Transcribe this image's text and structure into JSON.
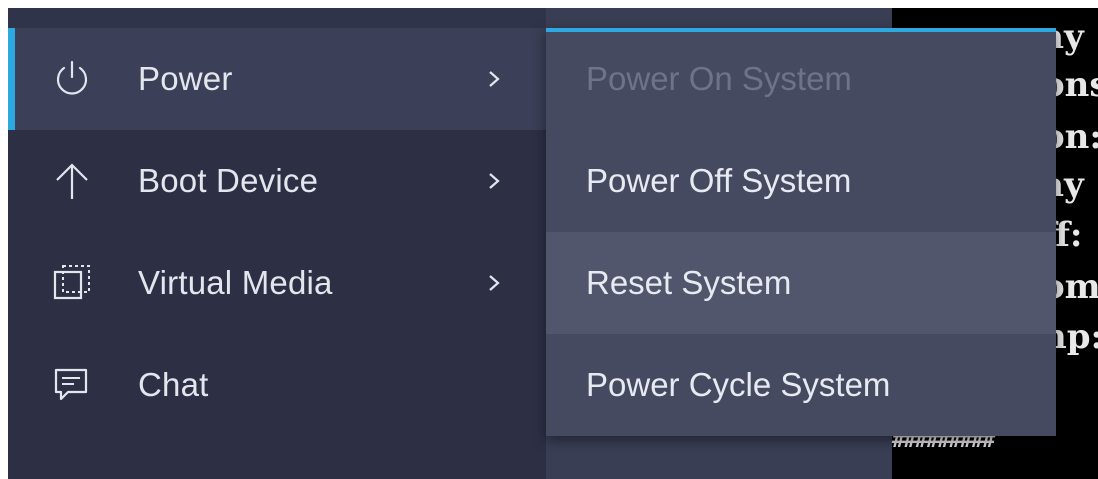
{
  "menu": {
    "items": [
      {
        "label": "Power",
        "icon": "power-icon",
        "has_submenu": true,
        "active": true
      },
      {
        "label": "Boot Device",
        "icon": "arrow-up-icon",
        "has_submenu": true
      },
      {
        "label": "Virtual Media",
        "icon": "virtual-media-icon",
        "has_submenu": true
      },
      {
        "label": "Chat",
        "icon": "chat-icon",
        "has_submenu": false
      }
    ]
  },
  "submenu": {
    "items": [
      {
        "label": "Power On System",
        "state": "disabled"
      },
      {
        "label": "Power Off System",
        "state": "normal"
      },
      {
        "label": "Reset System",
        "state": "hover"
      },
      {
        "label": "Power Cycle System",
        "state": "normal"
      }
    ]
  },
  "console": {
    "lines": [
      "ay",
      "ons",
      "on:",
      "ay",
      "ff:",
      "omm",
      "np:"
    ],
    "hash_line": "#########"
  },
  "colors": {
    "accent": "#2ea8e0",
    "menu_bg": "#2d3045",
    "submenu_bg": "#464a61",
    "hover_bg": "#52566d"
  }
}
